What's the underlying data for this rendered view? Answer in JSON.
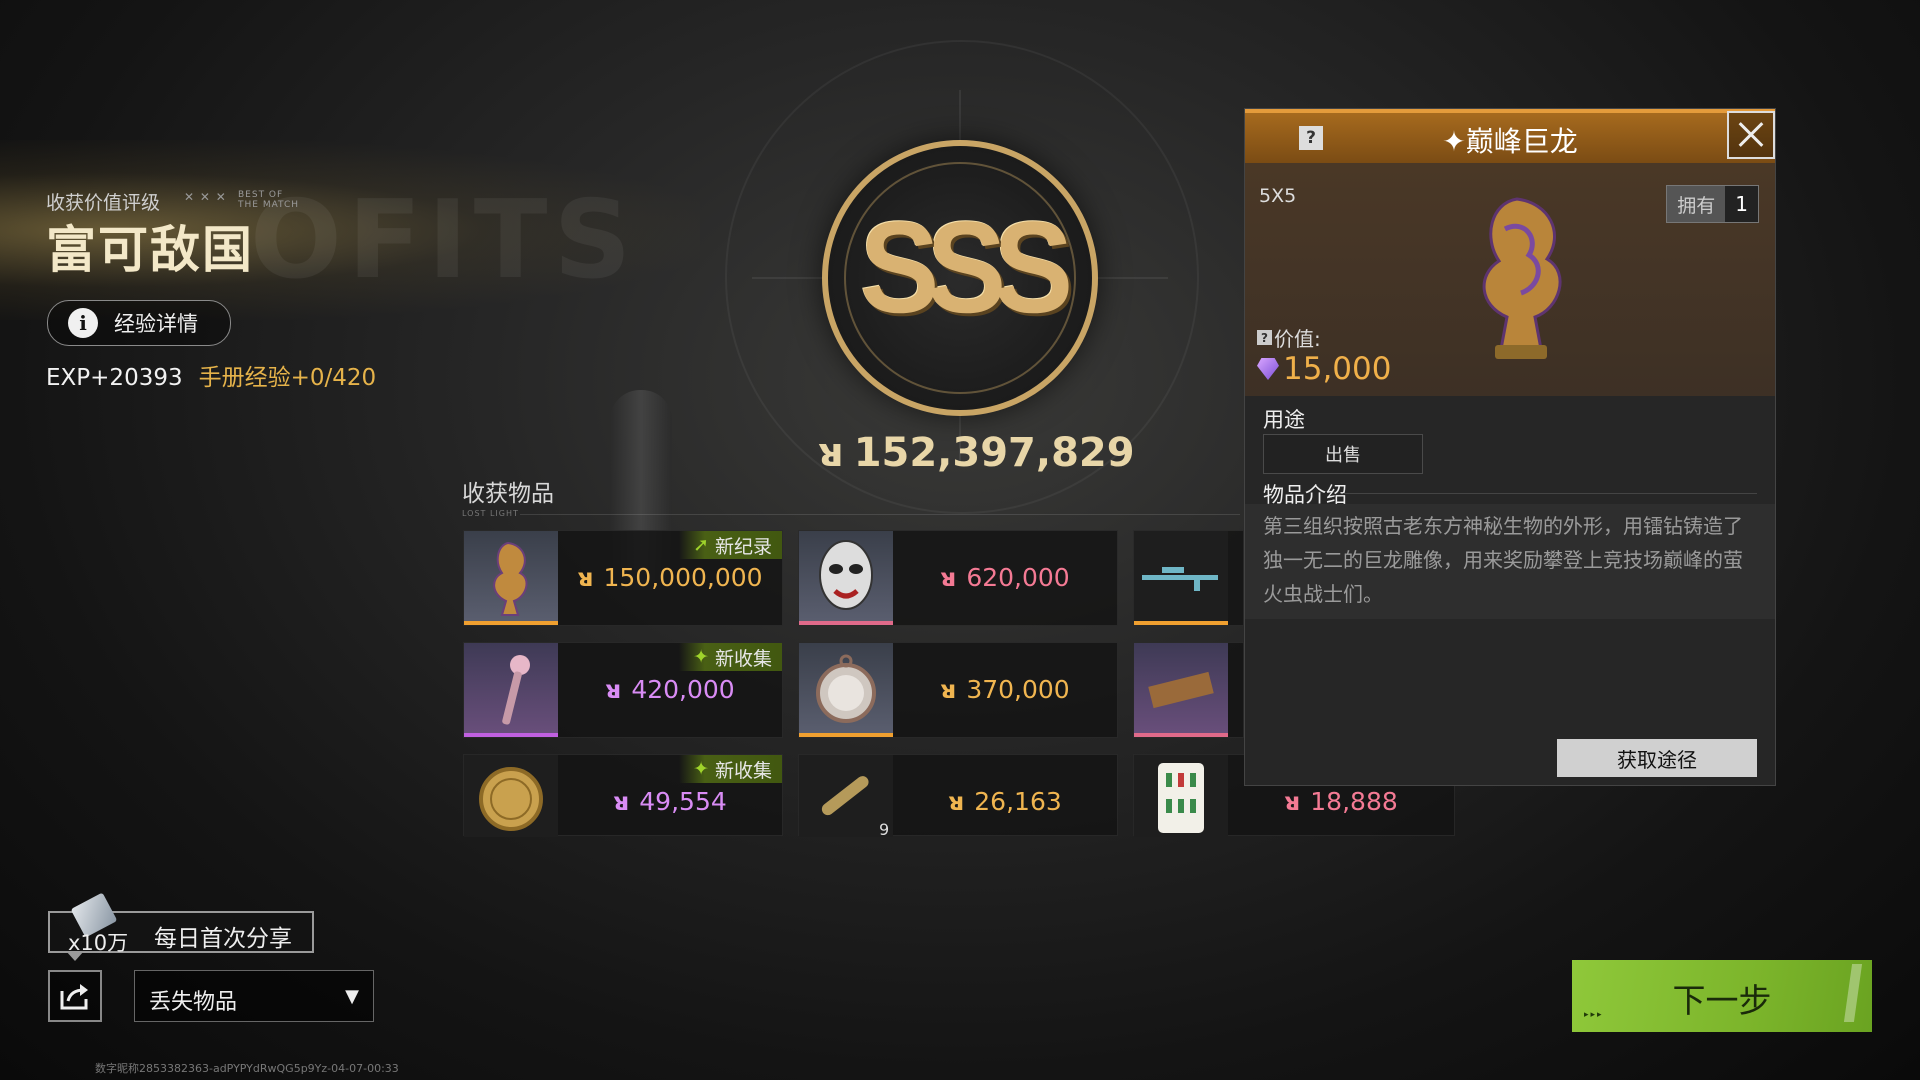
{
  "header": {
    "rating_subtitle": "收获价值评级",
    "best_of_line1": "BEST OF",
    "best_of_line2": "THE MATCH",
    "rating_title": "富可敌国",
    "bg_word": "OFITS"
  },
  "exp": {
    "details_button": "经验详情",
    "exp_text": "EXP+20393",
    "manual_text": "手册经验+0/420"
  },
  "grade": {
    "label": "SSS",
    "total_value": "152,397,829"
  },
  "loot": {
    "title": "收获物品",
    "subtitle": "LOST LIGHT",
    "items": [
      {
        "price": "150,000,000",
        "badge": "新纪录",
        "color": "gold"
      },
      {
        "price": "620,000",
        "color": "pink"
      },
      {
        "price": "420,000",
        "badge": "新收集",
        "color": "purple"
      },
      {
        "price": "370,000",
        "color": "gold"
      },
      {
        "price": "49,554",
        "badge": "新收集",
        "color": "purple"
      },
      {
        "price": "26,163",
        "count": "9",
        "color": "gold"
      },
      {
        "price": "18,888",
        "color": "pink"
      }
    ]
  },
  "detail": {
    "title": "巅峰巨龙",
    "size": "5X5",
    "owned_label": "拥有",
    "owned_value": "1",
    "value_label": "价值:",
    "value": "15,000",
    "usage_header": "用途",
    "usage_button": "出售",
    "intro_header": "物品介绍",
    "description": "第三组织按照古老东方神秘生物的外形，用镭钻铸造了独一无二的巨龙雕像，用来奖励攀登上竞技场巅峰的萤火虫战士们。",
    "obtain_button": "获取途径"
  },
  "bottom": {
    "share_multiplier": "x10万",
    "share_label": "每日首次分享",
    "lost_items_label": "丢失物品",
    "next_button": "下一步",
    "footer_text": "数字昵称2853382363-adPYPYdRwQG5p9Yz-04-07-00:33"
  },
  "colors": {
    "gold": "#f0b550",
    "purple": "#d98cf5",
    "pink": "#f47a94",
    "accent_green": "#8fc83a",
    "panel_header": "#a66a1e"
  },
  "icons": {
    "coin": "coin-icon",
    "gem": "gem-icon",
    "info": "info-icon",
    "share": "share-icon",
    "close": "close-icon"
  }
}
